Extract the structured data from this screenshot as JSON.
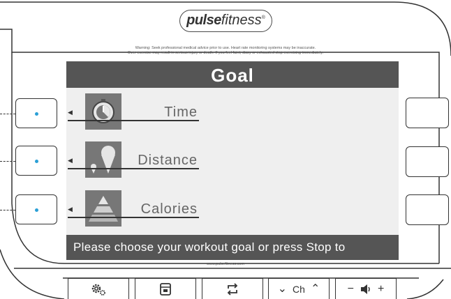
{
  "brand": {
    "name_bold": "pulse",
    "name_light": "fitness",
    "registered": "®"
  },
  "warning": {
    "line1": "Warning: Seek professional medical advice prior to use. Heart rate monitoring systems may be inaccurate.",
    "line2": "Over exercise may result in serious injury or death.  If you feel faint, dizzy or exhausted stop exercising immediately."
  },
  "screen": {
    "title": "Goal",
    "goals": [
      {
        "label": "Time",
        "icon": "stopwatch-icon"
      },
      {
        "label": "Distance",
        "icon": "map-pin-icon"
      },
      {
        "label": "Calories",
        "icon": "pyramid-icon"
      }
    ],
    "prompt": "Please choose your workout goal or press Stop to"
  },
  "footer": {
    "url": "www.pulsefitness.com"
  },
  "bottom_bar": {
    "settings_icon": "settings-gears-icon",
    "window_icon": "window-switch-icon",
    "repeat_icon": "repeat-icon",
    "channel_label": "Ch",
    "volume_minus": "−",
    "volume_plus": "+"
  },
  "colors": {
    "header_bg": "#555555",
    "screen_bg": "#efefef",
    "accent_dot": "#2a9fd6",
    "outline": "#333333"
  }
}
